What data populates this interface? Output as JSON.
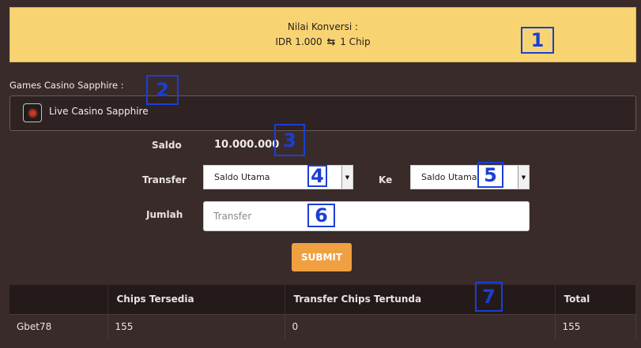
{
  "conversion": {
    "title": "Nilai Konversi :",
    "left": "IDR 1.000",
    "icon": "exchange-icon",
    "right": "1 Chip"
  },
  "games": {
    "section_label": "Games Casino Sapphire :",
    "item_label": "Live Casino Sapphire"
  },
  "form": {
    "saldo_label": "Saldo",
    "saldo_value": "10.000.000",
    "transfer_label": "Transfer",
    "transfer_from": "Saldo Utama",
    "ke_label": "Ke",
    "transfer_to": "Saldo Utama",
    "jumlah_label": "Jumlah",
    "jumlah_placeholder": "Transfer",
    "submit_label": "SUBMIT"
  },
  "table": {
    "headers": [
      "",
      "Chips Tersedia",
      "Transfer Chips Tertunda",
      "Total"
    ],
    "rows": [
      [
        "Gbet78",
        "155",
        "0",
        "155"
      ]
    ]
  },
  "markers": [
    "1",
    "2",
    "3",
    "4",
    "5",
    "6",
    "7"
  ]
}
